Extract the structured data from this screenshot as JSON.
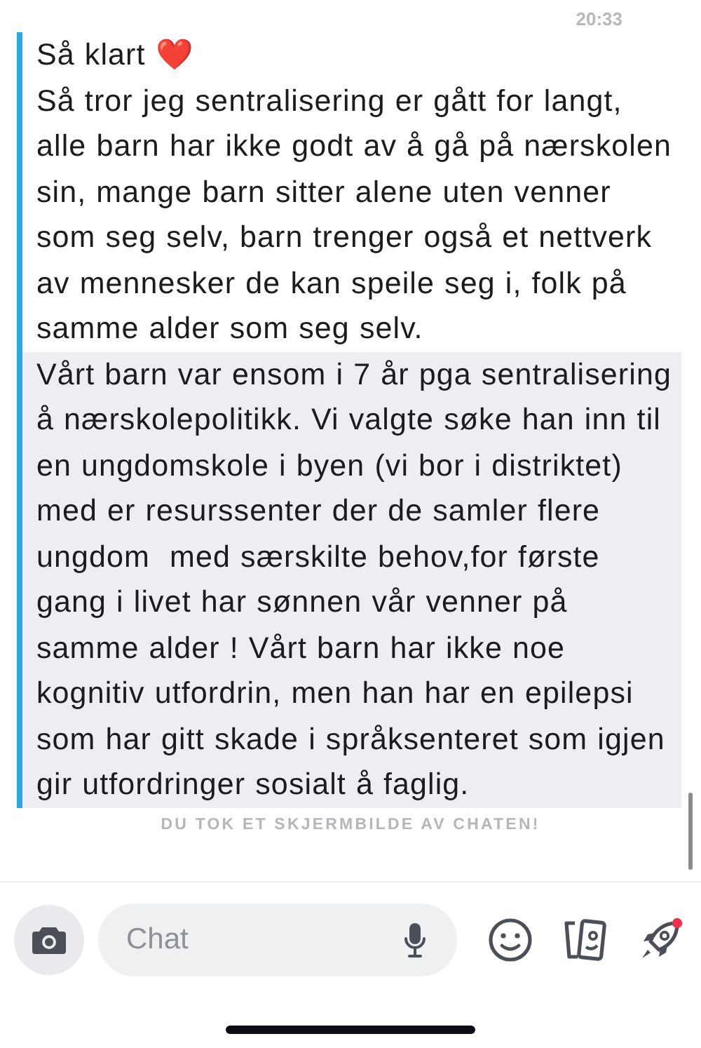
{
  "timestamp": "20:33",
  "messages": [
    {
      "text": "Så klart ❤️",
      "saved": false
    },
    {
      "text": "Så tror jeg sentralisering er gått for langt, alle barn har ikke godt av å gå på nærskolen sin, mange barn sitter alene uten venner som seg selv, barn trenger også et nettverk av mennesker de kan speile seg i, folk på samme alder som seg selv.",
      "saved": false
    },
    {
      "text": "Vårt barn var ensom i 7 år pga sentralisering å nærskolepolitikk. Vi valgte søke han inn til en ungdomskole i byen (vi bor i distriktet) med er resurssenter der de samler flere ungdom  med særskilte behov,for første gang i livet har sønnen vår venner på samme alder ! Vårt barn har ikke noe kognitiv utfordrin, men han har en epilepsi som har gitt skade i språksenteret som igjen gir utfordringer sosialt å faglig.",
      "saved": true
    }
  ],
  "notice": "DU TOK ET SKJERMBILDE AV CHATEN!",
  "composer": {
    "placeholder": "Chat"
  },
  "toolbar": {
    "has_notification": true
  }
}
